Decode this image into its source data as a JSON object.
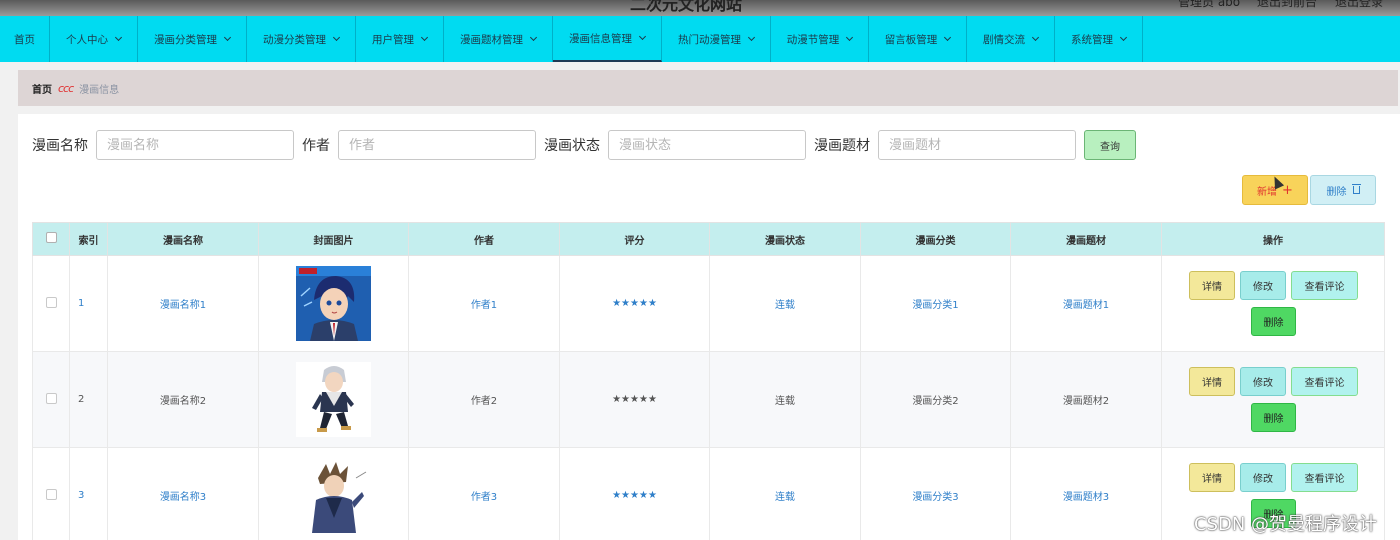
{
  "header": {
    "site_title": "二次元文化网站",
    "user_info": "管理员 abo",
    "back_to_front": "退出到前台",
    "logout": "退出登录"
  },
  "nav": {
    "items": [
      {
        "label": "首页",
        "dropdown": false
      },
      {
        "label": "个人中心",
        "dropdown": true
      },
      {
        "label": "漫画分类管理",
        "dropdown": true
      },
      {
        "label": "动漫分类管理",
        "dropdown": true
      },
      {
        "label": "用户管理",
        "dropdown": true
      },
      {
        "label": "漫画题材管理",
        "dropdown": true
      },
      {
        "label": "漫画信息管理",
        "dropdown": true,
        "active": true
      },
      {
        "label": "热门动漫管理",
        "dropdown": true
      },
      {
        "label": "动漫节管理",
        "dropdown": true
      },
      {
        "label": "留言板管理",
        "dropdown": true
      },
      {
        "label": "剧情交流",
        "dropdown": true
      },
      {
        "label": "系统管理",
        "dropdown": true
      }
    ],
    "bg_color": "#00dbf1"
  },
  "breadcrumb": {
    "home": "首页",
    "separator": "ccc",
    "current": "漫画信息"
  },
  "search": {
    "name_label": "漫画名称",
    "name_placeholder": "漫画名称",
    "author_label": "作者",
    "author_placeholder": "作者",
    "status_label": "漫画状态",
    "status_placeholder": "漫画状态",
    "theme_label": "漫画题材",
    "theme_placeholder": "漫画题材",
    "query_button": "查询"
  },
  "actions": {
    "add_label": "新增",
    "add_icon": "plus-icon",
    "delete_label": "删除",
    "delete_icon": "trash-icon"
  },
  "table": {
    "columns": [
      "索引",
      "漫画名称",
      "封面图片",
      "作者",
      "评分",
      "漫画状态",
      "漫画分类",
      "漫画题材",
      "操作"
    ],
    "rows": [
      {
        "index": "1",
        "name": "漫画名称1",
        "author": "作者1",
        "rating": "★★★★★",
        "status": "连载",
        "category": "漫画分类1",
        "theme": "漫画题材1"
      },
      {
        "index": "2",
        "name": "漫画名称2",
        "author": "作者2",
        "rating": "★★★★★",
        "status": "连载",
        "category": "漫画分类2",
        "theme": "漫画题材2"
      },
      {
        "index": "3",
        "name": "漫画名称3",
        "author": "作者3",
        "rating": "★★★★★",
        "status": "连载",
        "category": "漫画分类3",
        "theme": "漫画题材3"
      }
    ],
    "row_actions": {
      "detail": "详情",
      "edit": "修改",
      "comments": "查看评论",
      "delete": "删除"
    }
  },
  "watermark": "CSDN @贺曼程序设计"
}
